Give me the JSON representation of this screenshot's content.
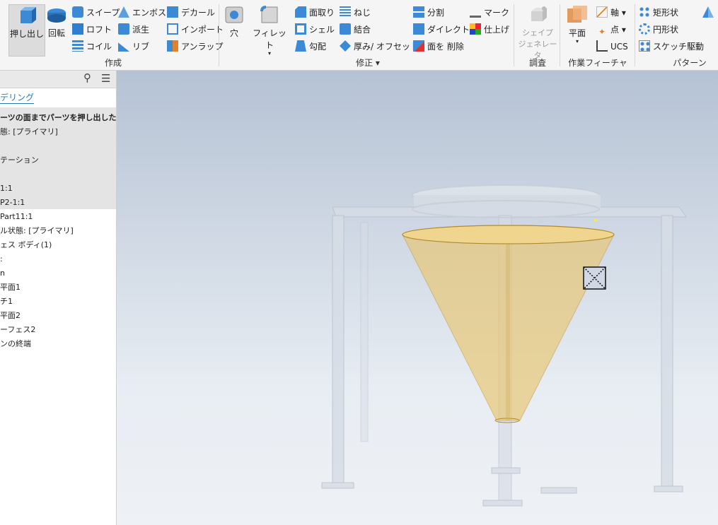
{
  "ribbon": {
    "create": {
      "extrude": "押し出し",
      "revolve": "回転",
      "sweep": "スイープ",
      "loft": "ロフト",
      "coil": "コイル",
      "emboss": "エンボス",
      "derive": "派生",
      "rib": "リブ",
      "decal": "デカール",
      "import": "インポート",
      "unwrap": "アンラップ",
      "group_label": "作成"
    },
    "modify": {
      "hole": "穴",
      "fillet": "フィレット",
      "chamfer": "面取り",
      "shell": "シェル",
      "draft": "勾配",
      "thread": "ねじ",
      "combine": "結合",
      "thicken": "厚み/ オフセット",
      "split": "分割",
      "direct": "ダイレクト",
      "delete_face": "面を 削除",
      "mark": "マーク",
      "finish": "仕上げ",
      "group_label": "修正"
    },
    "explore": {
      "shape_generator_line1": "シェイプ",
      "shape_generator_line2": "ジェネレータ",
      "group_label": "調査"
    },
    "work_features": {
      "plane": "平面",
      "axis": "軸",
      "point": "点",
      "ucs": "UCS",
      "group_label": "作業フィーチャ"
    },
    "pattern": {
      "rectangular": "矩形状",
      "circular": "円形状",
      "sketch_driven": "スケッチ駆動",
      "group_label": "パターン"
    }
  },
  "browser": {
    "tab": "デリング",
    "rows": [
      "ーツの面までパーツを押し出しため",
      "態: [プライマリ]",
      "テーション",
      "1:1",
      "P2-1:1",
      "Part11:1",
      "ル状態: [プライマリ]",
      "ェス ボディ(1)",
      ":",
      "n",
      "平面1",
      "チ1",
      "平面2",
      "ーフェス2",
      "ンの終端"
    ]
  },
  "colors": {
    "funnel": "#e9c66f",
    "accent": "#2a7ab8"
  }
}
